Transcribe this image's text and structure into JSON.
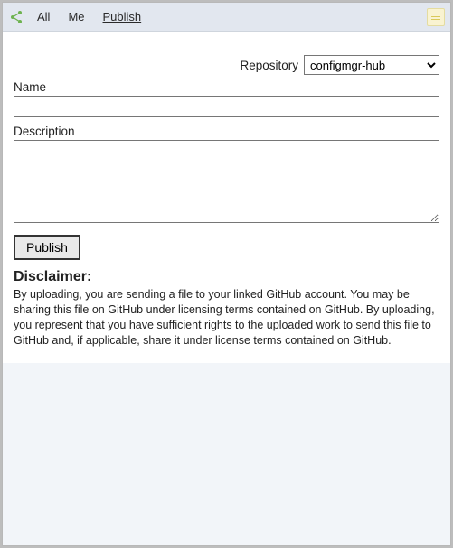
{
  "toolbar": {
    "tabs": {
      "all": "All",
      "me": "Me",
      "publish": "Publish"
    }
  },
  "form": {
    "repository_label": "Repository",
    "repository_value": "configmgr-hub",
    "name_label": "Name",
    "name_value": "",
    "description_label": "Description",
    "description_value": "",
    "publish_button": "Publish"
  },
  "disclaimer": {
    "heading": "Disclaimer:",
    "body": "By uploading, you are sending a file to your linked GitHub account. You may be sharing this file on GitHub under licensing terms contained on GitHub. By uploading, you represent that you have sufficient rights to the uploaded work to send this file to GitHub and, if applicable, share it under license terms contained on GitHub."
  }
}
